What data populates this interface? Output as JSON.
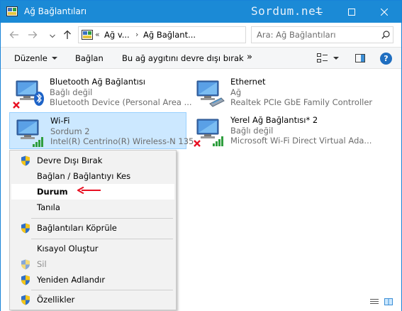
{
  "window": {
    "title": "Ağ Bağlantıları",
    "watermark": "Sordum.net"
  },
  "address": {
    "overflow": "«",
    "crumb1": "Ağ v...",
    "crumb2": "Ağ Bağlant...",
    "chevron": "›"
  },
  "search": {
    "placeholder": "Ara: Ağ Bağlantıları"
  },
  "commands": {
    "organize": "Düzenle",
    "connect": "Bağlan",
    "disable": "Bu ağ aygıtını devre dışı bırak",
    "more": "»"
  },
  "help": {
    "label": "?"
  },
  "connections": [
    {
      "name": "Bluetooth Ağ Bağlantısı",
      "status": "Bağlı değil",
      "device": "Bluetooth Device (Personal Area ..."
    },
    {
      "name": "Ethernet",
      "status": "Ağ",
      "device": "Realtek PCIe GbE Family Controller"
    },
    {
      "name": "Wi-Fi",
      "status": "Sordum 2",
      "device": "Intel(R) Centrino(R) Wireless-N 135"
    },
    {
      "name": "Yerel Ağ Bağlantısı* 2",
      "status": "Bağlı değil",
      "device": "Microsoft Wi-Fi Direct Virtual Ada..."
    }
  ],
  "context_menu": {
    "items": [
      {
        "label": "Devre Dışı Bırak"
      },
      {
        "label": "Bağlan / Bağlantıyı Kes"
      },
      {
        "label": "Durum"
      },
      {
        "label": "Tanıla"
      },
      {
        "label": "Bağlantıları Köprüle"
      },
      {
        "label": "Kısayol Oluştur"
      },
      {
        "label": "Sil"
      },
      {
        "label": "Yeniden Adlandır"
      },
      {
        "label": "Özellikler"
      }
    ]
  },
  "colors": {
    "titlebar": "#1b8ad6",
    "selection": "#cce8ff",
    "accent_red": "#e81123"
  }
}
